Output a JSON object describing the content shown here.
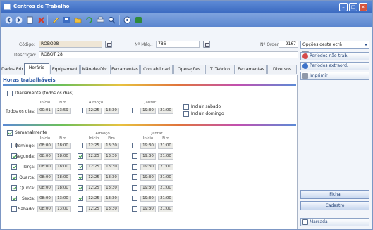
{
  "window": {
    "title": "Centros de Trabalho"
  },
  "colors": {
    "titlebar": "#3a69c0",
    "accent": "#2e5aa5",
    "check": "#2f9b3a",
    "tan_field": "#efe6d6"
  },
  "toolbar": {
    "icons": [
      "back-icon",
      "forward-icon",
      "new-icon",
      "delete-icon",
      "edit-icon",
      "save-icon",
      "open-icon",
      "refresh-icon",
      "print-icon",
      "find-icon",
      "help-icon",
      "stop-icon"
    ]
  },
  "header": {
    "codigo_label": "Código:",
    "codigo_value": "ROBO28",
    "maq_label": "Nº Máq.:",
    "maq_value": "786",
    "ordem_label": "Nº Ordem:",
    "ordem_value": "9167",
    "descricao_label": "Descrição:",
    "descricao_value": "ROBOT 28"
  },
  "tabs": [
    {
      "label": "Dados Princi"
    },
    {
      "label": "Horário"
    },
    {
      "label": "Equipament"
    },
    {
      "label": "Mão-de-Obr"
    },
    {
      "label": "Ferramentas"
    },
    {
      "label": "Contabilidad"
    },
    {
      "label": "Operações"
    },
    {
      "label": "T. Teórico"
    },
    {
      "label": "Ferramentas"
    },
    {
      "label": "Diversos"
    }
  ],
  "horas": {
    "title": "Horas trabalháveis",
    "diariamente_label": "Diariamente (todos os dias)",
    "inicio": "Início",
    "fim": "Fim",
    "almoco": "Almoço",
    "jantar": "Jantar",
    "todos_label": "Todos os dias:",
    "todos": {
      "inicio": "00:01",
      "fim": "23:59",
      "alm_ini": "12:25",
      "alm_fim": "13:30",
      "jan_ini": "19:30",
      "jan_fim": "21:00"
    },
    "incluir_sabado": "Incluir sábado",
    "incluir_domingo": "Incluir domingo",
    "semanal_label": "Semanalmente",
    "days": [
      {
        "name": "Domingo:",
        "on": false,
        "inicio": "08:00",
        "fim": "18:00",
        "alm_on": false,
        "alm_ini": "12:25",
        "alm_fim": "13:30",
        "jan_on": false,
        "jan_ini": "19:30",
        "jan_fim": "21:00"
      },
      {
        "name": "Segunda:",
        "on": true,
        "inicio": "08:00",
        "fim": "18:00",
        "alm_on": true,
        "alm_ini": "12:25",
        "alm_fim": "13:30",
        "jan_on": false,
        "jan_ini": "19:30",
        "jan_fim": "21:00"
      },
      {
        "name": "Terça:",
        "on": true,
        "inicio": "08:00",
        "fim": "18:00",
        "alm_on": true,
        "alm_ini": "12:25",
        "alm_fim": "13:30",
        "jan_on": false,
        "jan_ini": "19:30",
        "jan_fim": "21:00"
      },
      {
        "name": "Quarta:",
        "on": true,
        "inicio": "08:00",
        "fim": "18:00",
        "alm_on": true,
        "alm_ini": "12:25",
        "alm_fim": "13:30",
        "jan_on": false,
        "jan_ini": "19:30",
        "jan_fim": "21:00"
      },
      {
        "name": "Quinta:",
        "on": true,
        "inicio": "08:00",
        "fim": "18:00",
        "alm_on": true,
        "alm_ini": "12:25",
        "alm_fim": "13:30",
        "jan_on": false,
        "jan_ini": "19:30",
        "jan_fim": "21:00"
      },
      {
        "name": "Sexta:",
        "on": true,
        "inicio": "08:00",
        "fim": "13:00",
        "alm_on": true,
        "alm_ini": "12:25",
        "alm_fim": "13:30",
        "jan_on": false,
        "jan_ini": "19:30",
        "jan_fim": "21:00"
      },
      {
        "name": "Sábado:",
        "on": false,
        "inicio": "08:00",
        "fim": "13:00",
        "alm_on": false,
        "alm_ini": "12:25",
        "alm_fim": "13:30",
        "jan_on": false,
        "jan_ini": "19:30",
        "jan_fim": "21:00"
      }
    ]
  },
  "sidebar": {
    "options_label": "Opções deste ecrã",
    "periodos_nao_trab": "Períodos não-trab.",
    "periodos_extraord": "Períodos extraord.",
    "imprimir": "Imprimir",
    "ficha": "Ficha",
    "cadastro": "Cadastro",
    "marcada": "Marcada"
  }
}
